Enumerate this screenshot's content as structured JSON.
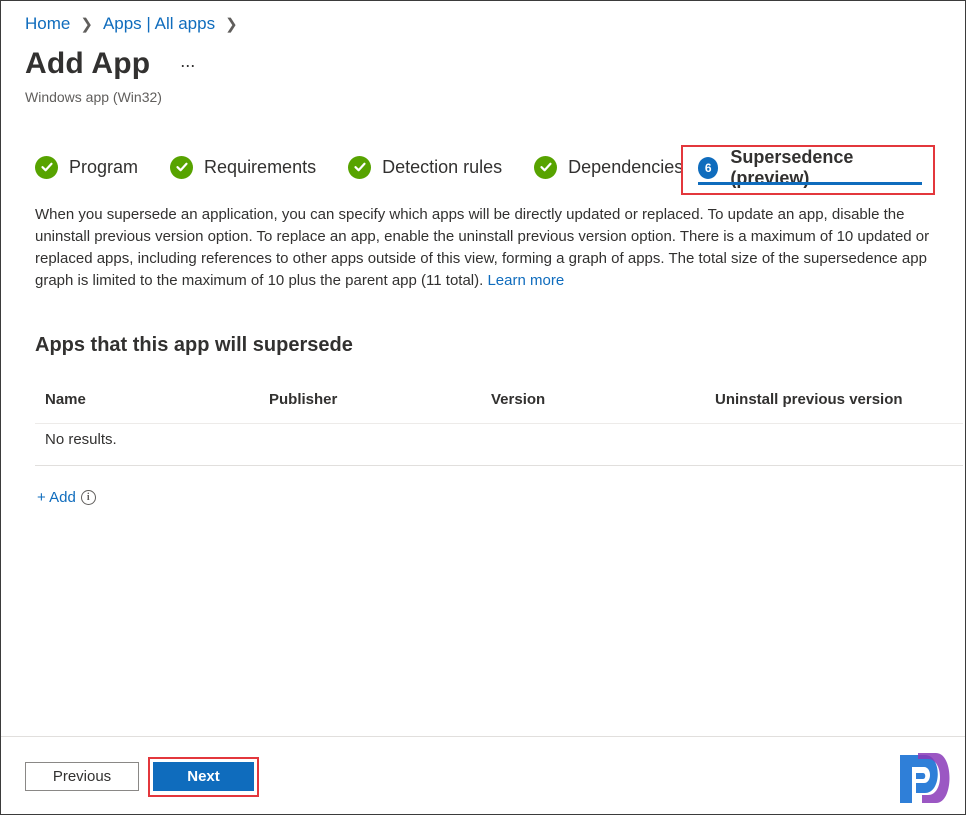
{
  "breadcrumb": {
    "home": "Home",
    "apps": "Apps | All apps"
  },
  "header": {
    "title": "Add App",
    "more": "...",
    "subtitle": "Windows app (Win32)"
  },
  "tabs": [
    {
      "label": "Program",
      "state": "complete"
    },
    {
      "label": "Requirements",
      "state": "complete"
    },
    {
      "label": "Detection rules",
      "state": "complete"
    },
    {
      "label": "Dependencies",
      "state": "complete"
    }
  ],
  "active_tab": {
    "step": "6",
    "label": "Supersedence (preview)"
  },
  "description": {
    "text": "When you supersede an application, you can specify which apps will be directly updated or replaced. To update an app, disable the uninstall previous version option. To replace an app, enable the uninstall previous version option. There is a maximum of 10 updated or replaced apps, including references to other apps outside of this view, forming a graph of apps. The total size of the supersedence app graph is limited to the maximum of 10 plus the parent app (11 total).",
    "link": "Learn more"
  },
  "section": {
    "title": "Apps that this app will supersede"
  },
  "table": {
    "columns": [
      "Name",
      "Publisher",
      "Version",
      "Uninstall previous version"
    ],
    "empty": "No results."
  },
  "add": {
    "label": "+ Add",
    "info": "i"
  },
  "footer": {
    "previous": "Previous",
    "next": "Next"
  },
  "colors": {
    "accent": "#0f6cbd",
    "success": "#57a300",
    "highlight": "#e3373c"
  }
}
